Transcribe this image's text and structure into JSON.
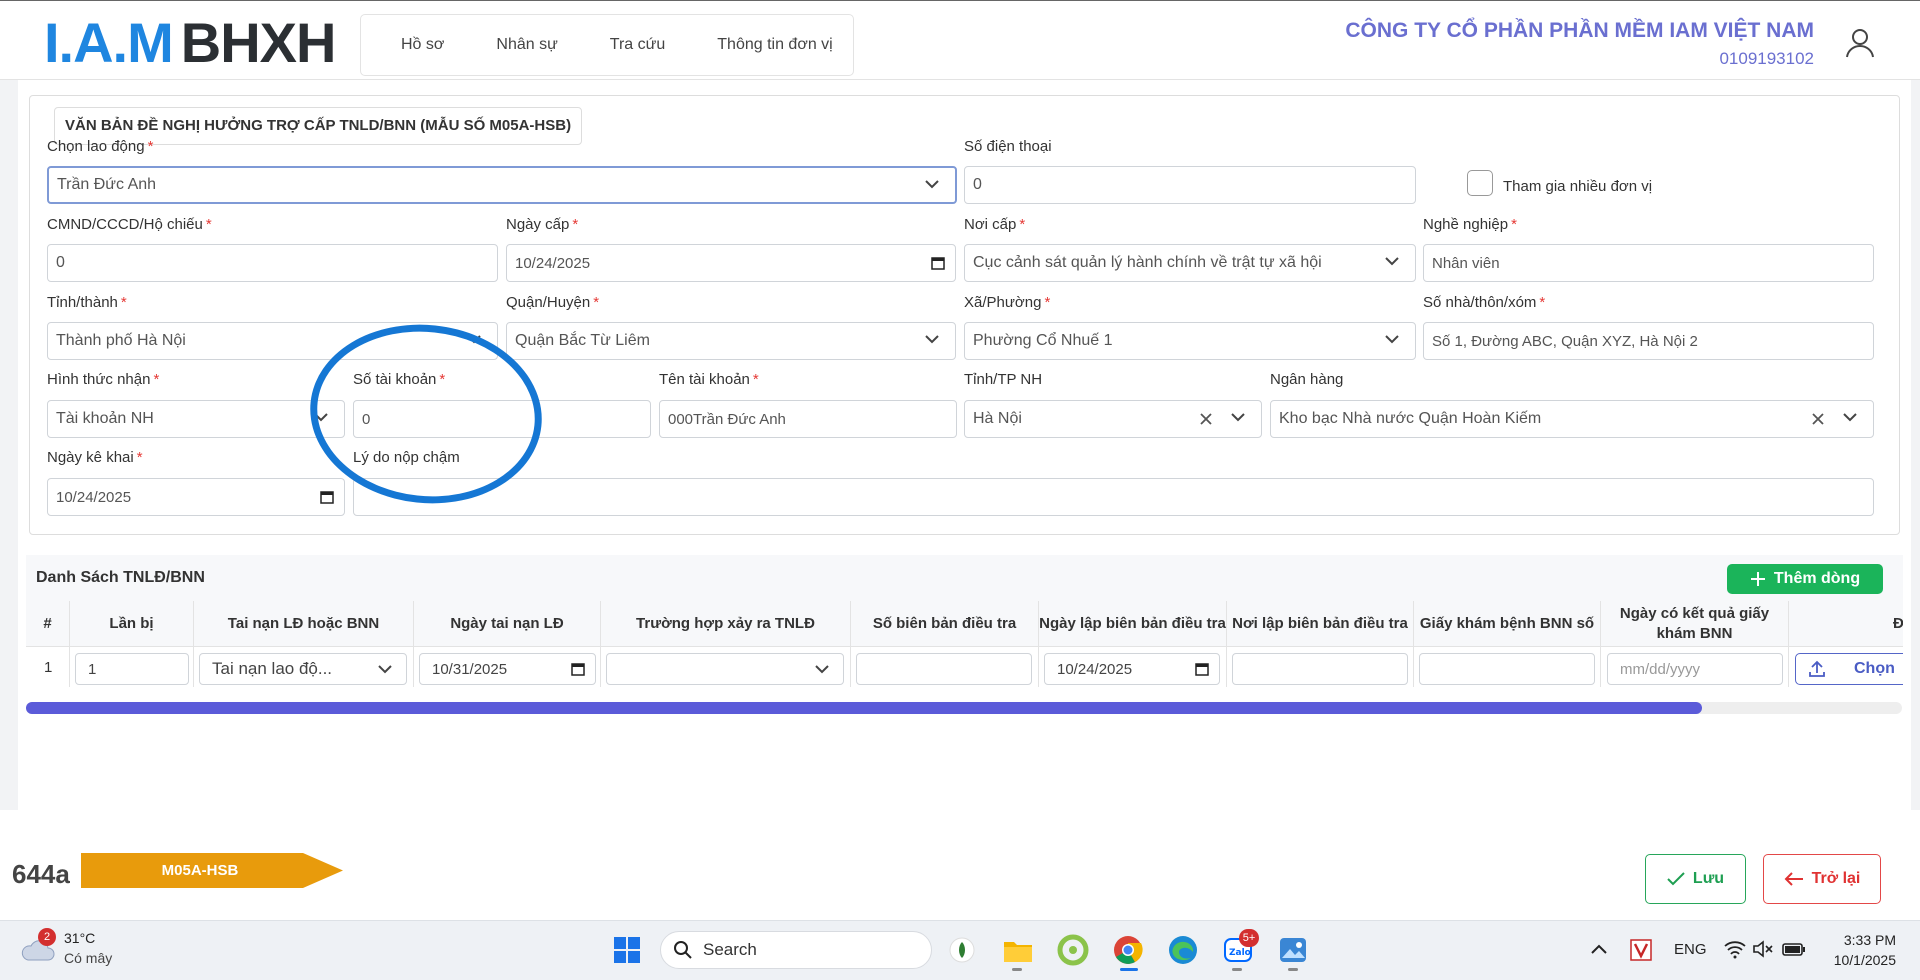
{
  "header": {
    "logo_iam": "I.A.M",
    "logo_bhxh": "BHXH",
    "nav": [
      "Hồ sơ",
      "Nhân sự",
      "Tra cứu",
      "Thông tin đơn vị"
    ],
    "company_name": "CÔNG TY CỔ PHẦN PHẦN MỀM IAM VIỆT NAM",
    "tax_code": "0109193102"
  },
  "form": {
    "legend": "VĂN BẢN ĐỀ NGHỊ HƯỞNG TRỢ CẤP TNLD/BNN (MẪU SỐ M05A-HSB)",
    "employee": {
      "label": "Chọn lao động",
      "required": "*",
      "value": "Trần Đức Anh"
    },
    "phone": {
      "label": "Số điện thoại",
      "value": "0"
    },
    "multi_unit": {
      "label": "Tham gia nhiều đơn vị",
      "checked": false
    },
    "id_number": {
      "label": "CMND/CCCD/Hộ chiếu",
      "required": "*",
      "value": "0"
    },
    "issue_date": {
      "label": "Ngày cấp",
      "required": "*",
      "value": "10/24/2025"
    },
    "issue_place": {
      "label": "Nơi cấp",
      "required": "*",
      "value": "Cục cảnh sát quản lý hành chính về trật tự xã hội"
    },
    "occupation": {
      "label": "Nghề nghiệp",
      "required": "*",
      "value": "Nhân viên"
    },
    "province": {
      "label": "Tỉnh/thành",
      "required": "*",
      "value": "Thành phố Hà Nội"
    },
    "district": {
      "label": "Quận/Huyện",
      "required": "*",
      "value": "Quận Bắc Từ Liêm"
    },
    "ward": {
      "label": "Xã/Phường",
      "required": "*",
      "value": "Phường Cổ Nhuế 1"
    },
    "address": {
      "label": "Số nhà/thôn/xóm",
      "required": "*",
      "value": "Số 1, Đường ABC, Quận XYZ, Hà Nội 2"
    },
    "receive_method": {
      "label": "Hình thức nhận",
      "required": "*",
      "value": "Tài khoản NH"
    },
    "account_number": {
      "label": "Số tài khoản",
      "required": "*",
      "value": "0"
    },
    "account_name": {
      "label": "Tên tài khoản",
      "required": "*",
      "value": "000Trần Đức Anh"
    },
    "bank_province": {
      "label": "Tỉnh/TP NH",
      "value": "Hà Nội"
    },
    "bank": {
      "label": "Ngân hàng",
      "value": "Kho bạc Nhà nước Quận Hoàn Kiếm"
    },
    "declare_date": {
      "label": "Ngày kê khai",
      "required": "*",
      "value": "10/24/2025"
    },
    "late_reason": {
      "label": "Lý do nộp chậm",
      "value": ""
    }
  },
  "table": {
    "title": "Danh Sách TNLĐ/BNN",
    "add_button": "Thêm dòng",
    "columns": [
      "#",
      "Lần bị",
      "Tai nạn LĐ hoặc BNN",
      "Ngày tai nạn LĐ",
      "Trường hợp xảy ra TNLĐ",
      "Số biên bản điều tra",
      "Ngày lập biên bản điều tra",
      "Nơi lập biên bản điều tra",
      "Giấy khám bệnh BNN số",
      "Ngày có kết quả giấy khám BNN",
      "Đ"
    ],
    "rows": [
      {
        "index": "1",
        "times": "1",
        "type": "Tai nạn lao độ...",
        "accident_date": "10/31/2025",
        "case": "",
        "report_no": "",
        "report_date": "10/24/2025",
        "report_place": "",
        "exam_no": "",
        "result_date_placeholder": "mm/dd/yyyy",
        "choose": "Chọn"
      }
    ]
  },
  "footer": {
    "code": "644a",
    "form_badge": "M05A-HSB",
    "save": "Lưu",
    "back": "Trở lại"
  },
  "taskbar": {
    "weather_temp": "31°C",
    "weather_cond": "Có mây",
    "weather_badge": "2",
    "search": "Search",
    "zalo_badge": "5+",
    "lang": "ENG",
    "time": "3:33 PM",
    "date": "10/1/2025"
  },
  "colors": {
    "brand_blue": "#1f86e0",
    "company_purple": "#6a6fd0",
    "green": "#1bb45a",
    "red": "#e03232",
    "annotation_blue": "#1577d4",
    "badge_orange": "#e89b0c"
  }
}
